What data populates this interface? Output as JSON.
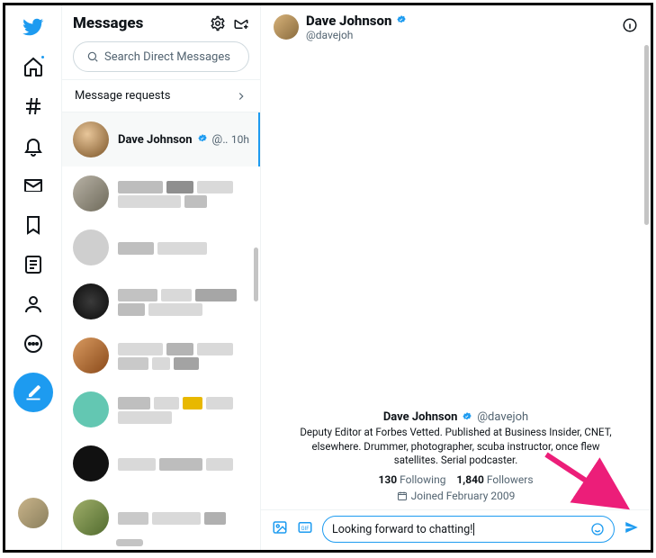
{
  "nav": {
    "items": [
      "twitter",
      "home",
      "explore",
      "notifications",
      "messages",
      "bookmarks",
      "lists",
      "profile",
      "more",
      "compose"
    ]
  },
  "messages": {
    "title": "Messages",
    "search_placeholder": "Search Direct Messages",
    "requests_label": "Message requests",
    "conversations": [
      {
        "name": "Dave Johnson",
        "verified": true,
        "handle": "@da...",
        "time": "10h",
        "active": true
      }
    ]
  },
  "conversation": {
    "header_name": "Dave Johnson",
    "header_verified": true,
    "header_handle": "@davejoh",
    "profile": {
      "name": "Dave Johnson",
      "handle": "@davejoh",
      "bio": "Deputy Editor at Forbes Vetted. Published at Business Insider, CNET, elsewhere. Drummer, photographer, scuba instructor, once flew satellites. Serial podcaster.",
      "following_count": "130",
      "following_label": "Following",
      "followers_count": "1,840",
      "followers_label": "Followers",
      "joined": "Joined February 2009"
    },
    "input_value": "Looking forward to chatting!"
  }
}
